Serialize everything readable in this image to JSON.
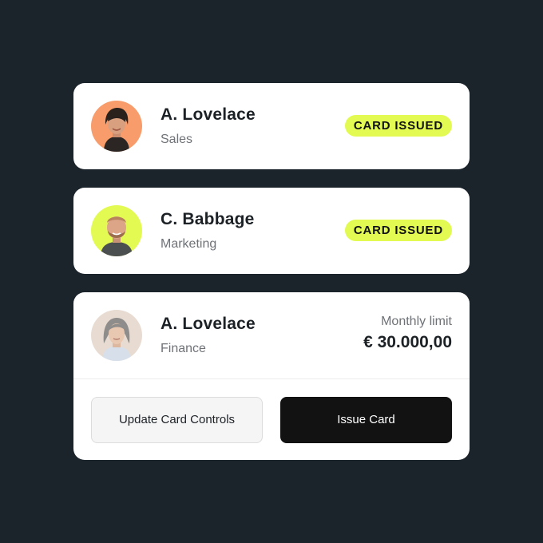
{
  "employees": [
    {
      "name": "A. Lovelace",
      "department": "Sales",
      "status": "CARD ISSUED",
      "avatar_bg": "#f79c6a"
    },
    {
      "name": "C. Babbage",
      "department": "Marketing",
      "status": "CARD ISSUED",
      "avatar_bg": "#e3fa52"
    },
    {
      "name": "A. Lovelace",
      "department": "Finance",
      "avatar_bg": "#e8dcd2"
    }
  ],
  "limit": {
    "label": "Monthly limit",
    "value": "€ 30.000,00"
  },
  "actions": {
    "update_label": "Update Card Controls",
    "issue_label": "Issue Card"
  },
  "colors": {
    "background": "#1b242b",
    "badge": "#e3fa52",
    "primary_button": "#121212"
  }
}
